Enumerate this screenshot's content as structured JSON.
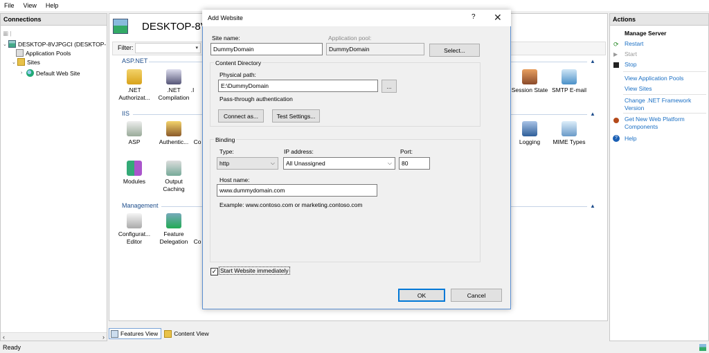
{
  "menubar": {
    "items": [
      "File",
      "View",
      "Help"
    ]
  },
  "connections": {
    "title": "Connections",
    "tree": [
      {
        "label": "DESKTOP-8VJPGCI (DESKTOP-",
        "icon": "server-icon"
      },
      {
        "label": "Application Pools",
        "icon": "app-pool-icon"
      },
      {
        "label": "Sites",
        "icon": "folder-icon"
      },
      {
        "label": "Default Web Site",
        "icon": "globe-icon"
      }
    ]
  },
  "main": {
    "title": "DESKTOP-8VJ",
    "filter_label": "Filter:",
    "groups": [
      {
        "name": "ASP.NET"
      },
      {
        "name": "IIS"
      },
      {
        "name": "Management"
      }
    ],
    "features": {
      "net_auth": ".NET\nAuthorizat...",
      "net_comp": ".NET\nCompilation",
      "session_state": "Session State",
      "smtp": "SMTP E-mail",
      "asp": "ASP",
      "authentic": "Authentic...",
      "logging": "Logging",
      "mime": "MIME Types",
      "modules": "Modules",
      "output_caching": "Output\nCaching",
      "config_editor": "Configurat...\nEditor",
      "feature_delegation": "Feature\nDelegation",
      "co1": "Co",
      "co2": "Co",
      "dot": ".I"
    },
    "tabs": [
      "Features View",
      "Content View"
    ]
  },
  "actions": {
    "title": "Actions",
    "section": "Manage Server",
    "restart": "Restart",
    "start": "Start",
    "stop": "Stop",
    "view_pools": "View Application Pools",
    "view_sites": "View Sites",
    "change_net_1": "Change .NET Framework",
    "change_net_2": "Version",
    "get_new_1": "Get New Web Platform",
    "get_new_2": "Components",
    "help": "Help"
  },
  "status": {
    "text": "Ready"
  },
  "dialog": {
    "title": "Add Website",
    "help_glyph": "?",
    "close_glyph": "✕",
    "site_name_label": "Site name:",
    "site_name_value": "DummyDomain",
    "app_pool_label": "Application pool:",
    "app_pool_value": "DummyDomain",
    "select_button": "Select...",
    "content_dir_title": "Content Directory",
    "physical_path_label": "Physical path:",
    "physical_path_value": "E:\\DummyDomain",
    "browse_button": "...",
    "pass_through": "Pass-through authentication",
    "connect_as_button": "Connect as...",
    "test_settings_button": "Test Settings...",
    "binding_title": "Binding",
    "type_label": "Type:",
    "type_value": "http",
    "ip_label": "IP address:",
    "ip_value": "All Unassigned",
    "port_label": "Port:",
    "port_value": "80",
    "host_label": "Host name:",
    "host_value": "www.dummydomain.com",
    "example": "Example: www.contoso.com or marketing.contoso.com",
    "start_immediately": "Start Website immediately",
    "ok_button": "OK",
    "cancel_button": "Cancel"
  }
}
